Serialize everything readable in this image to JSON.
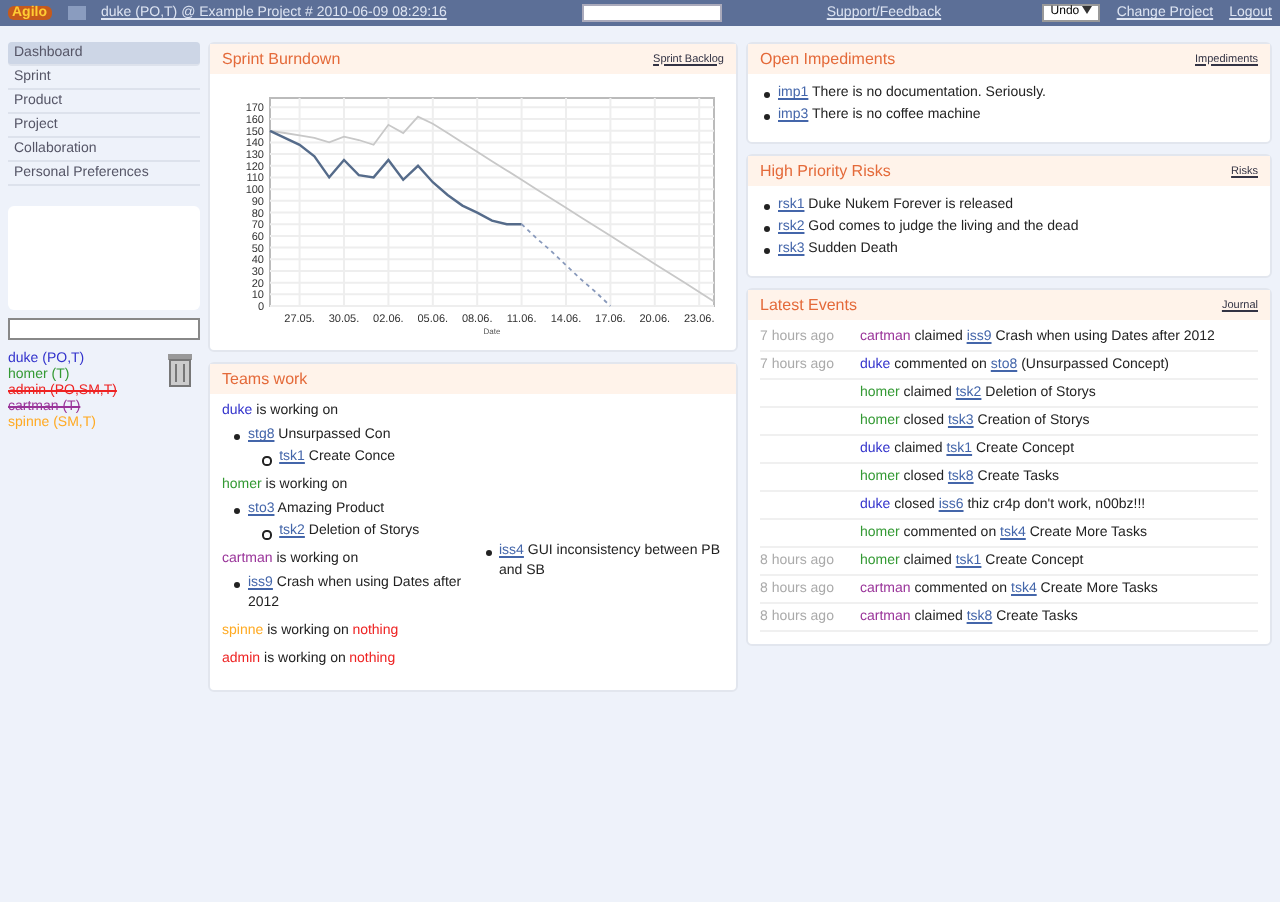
{
  "header": {
    "logo": "Agilo",
    "user_link": "duke (PO,T) @ Example Project # 2010-06-09 08:29:16",
    "support": "Support/Feedback",
    "undo": "Undo",
    "change_project": "Change Project",
    "logout": "Logout"
  },
  "sidebar": {
    "items": [
      {
        "label": "Dashboard",
        "selected": true
      },
      {
        "label": "Sprint",
        "selected": false
      },
      {
        "label": "Product",
        "selected": false
      },
      {
        "label": "Project",
        "selected": false
      },
      {
        "label": "Collaboration",
        "selected": false
      },
      {
        "label": "Personal Preferences",
        "selected": false
      }
    ],
    "users": [
      {
        "name": "duke (PO,T)",
        "color": "#3333cc",
        "crossed_out": false
      },
      {
        "name": "homer (T)",
        "color": "#339933",
        "crossed_out": false
      },
      {
        "name": "admin (PO,SM,T)",
        "color": "#ee2222",
        "crossed_out": true
      },
      {
        "name": "cartman (T)",
        "color": "#993399",
        "crossed_out": true
      },
      {
        "name": "spinne (SM,T)",
        "color": "#ffaa22",
        "crossed_out": false
      }
    ]
  },
  "burndown": {
    "title": "Sprint Burndown",
    "link": "Sprint Backlog",
    "chart_data": {
      "type": "line",
      "xlabel": "Date",
      "categories": [
        null,
        null,
        "27.05.",
        null,
        null,
        "30.05.",
        null,
        null,
        "02.06.",
        null,
        null,
        "05.06.",
        null,
        null,
        "08.06.",
        null,
        null,
        "11.06.",
        null,
        null,
        "14.06.",
        null,
        null,
        "17.06.",
        null,
        null,
        "20.06.",
        null,
        null,
        "23.06.",
        null
      ],
      "ylim": [
        0,
        178
      ],
      "grid": true,
      "yticks": [
        0,
        10,
        20,
        30,
        40,
        50,
        60,
        70,
        80,
        90,
        100,
        110,
        120,
        130,
        140,
        150,
        160,
        170
      ],
      "series": [
        {
          "color": "#c8c8c8",
          "line_style": "solid",
          "values": [
            150,
            148,
            146,
            144,
            140,
            145,
            142,
            138,
            155,
            148,
            162,
            156,
            148,
            140,
            132,
            124,
            116,
            108,
            100,
            92,
            84,
            76,
            68,
            60,
            52,
            44,
            36,
            28,
            20,
            12,
            4
          ]
        },
        {
          "color": "#556b8a",
          "line_style": "solid",
          "values": [
            150,
            144,
            138,
            128,
            110,
            125,
            112,
            110,
            125,
            108,
            120,
            106,
            95,
            86,
            80,
            73,
            70,
            70,
            null,
            null,
            null,
            null,
            null,
            null,
            null,
            null,
            null,
            null,
            null,
            null,
            null
          ]
        },
        {
          "color": "#8899bb",
          "line_style": "dashed",
          "values": [
            null,
            null,
            null,
            null,
            null,
            null,
            null,
            null,
            null,
            null,
            null,
            null,
            null,
            null,
            null,
            null,
            null,
            70,
            58,
            47,
            35,
            23,
            12,
            0,
            null,
            null,
            null,
            null,
            null,
            null,
            null
          ]
        }
      ]
    }
  },
  "team": {
    "title": "Teams work",
    "members": [
      {
        "user": "duke",
        "color": "#3333cc",
        "status": "is working on",
        "items": [
          {
            "ref": "stg8",
            "text": "Unsurpassed Con",
            "children": [
              {
                "ref": "tsk1",
                "text": "Create Conce"
              }
            ]
          }
        ]
      },
      {
        "user": "homer",
        "color": "#339933",
        "status": "is working on",
        "items": [
          {
            "ref": "sto3",
            "text": "Amazing Product",
            "children": [
              {
                "ref": "tsk2",
                "text": "Deletion of Storys"
              }
            ]
          }
        ]
      },
      {
        "user": "cartman",
        "color": "#993399",
        "status": "is working on",
        "items": [
          {
            "ref": "iss9",
            "text": "Crash when using Dates after 2012"
          }
        ]
      },
      {
        "user": "spinne",
        "color": "#ffaa22",
        "status": "is working on",
        "nothing": "nothing"
      },
      {
        "user": "admin",
        "color": "#ee2222",
        "status": "is working on",
        "nothing": "nothing"
      }
    ],
    "column_2_items": [
      {
        "ref": "iss4",
        "text": "GUI inconsistency between PB and SB"
      }
    ]
  },
  "impediments": {
    "title": "Open Impediments",
    "link": "Impediments",
    "items": [
      {
        "ref": "imp1",
        "text": "There is no documentation. Seriously."
      },
      {
        "ref": "imp3",
        "text": "There is no coffee machine"
      }
    ]
  },
  "risks": {
    "title": "High Priority Risks",
    "link": "Risks",
    "items": [
      {
        "ref": "rsk1",
        "text": "Duke Nukem Forever is released"
      },
      {
        "ref": "rsk2",
        "text": "God comes to judge the living and the dead"
      },
      {
        "ref": "rsk3",
        "text": "Sudden Death"
      }
    ]
  },
  "events": {
    "title": "Latest Events",
    "link": "Journal",
    "rows": [
      {
        "time": "7 hours ago",
        "user": "cartman",
        "color": "#993399",
        "action": "claimed",
        "ref": "iss9",
        "text": "Crash when using Dates after 2012"
      },
      {
        "time": "7 hours ago",
        "user": "duke",
        "color": "#3333cc",
        "action": "commented on",
        "ref": "sto8",
        "text": "(Unsurpassed Concept)"
      },
      {
        "user": "homer",
        "color": "#339933",
        "action": "claimed",
        "ref": "tsk2",
        "text": "Deletion of Storys"
      },
      {
        "user": "homer",
        "color": "#339933",
        "action": "closed",
        "ref": "tsk3",
        "text": "Creation of Storys"
      },
      {
        "user": "duke",
        "color": "#3333cc",
        "action": "claimed",
        "ref": "tsk1",
        "text": "Create Concept"
      },
      {
        "user": "homer",
        "color": "#339933",
        "action": "closed",
        "ref": "tsk8",
        "text": "Create Tasks"
      },
      {
        "user": "duke",
        "color": "#3333cc",
        "action": "closed",
        "ref": "iss6",
        "text": "thiz cr4p don't work, n00bz!!!"
      },
      {
        "user": "homer",
        "color": "#339933",
        "action": "commented on",
        "ref": "tsk4",
        "text": "Create More Tasks"
      },
      {
        "time": "8 hours ago",
        "user": "homer",
        "color": "#339933",
        "action": "claimed",
        "ref": "tsk1",
        "text": "Create Concept"
      },
      {
        "time": "8 hours ago",
        "user": "cartman",
        "color": "#993399",
        "action": "commented on",
        "ref": "tsk4",
        "text": "Create More Tasks"
      },
      {
        "time": "8 hours ago",
        "user": "cartman",
        "color": "#993399",
        "action": "claimed",
        "ref": "tsk8",
        "text": "Create Tasks"
      }
    ]
  }
}
